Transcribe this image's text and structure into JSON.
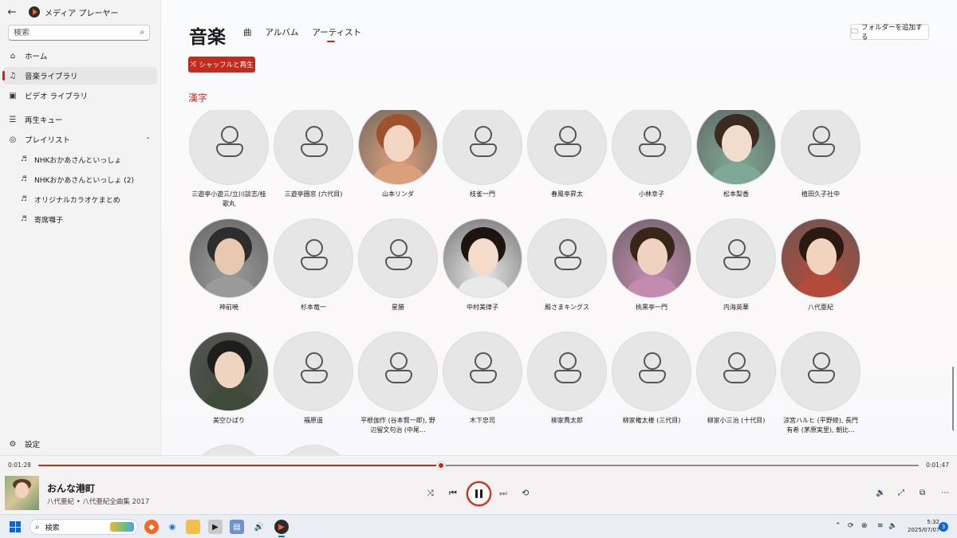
{
  "window": {
    "title": "メディア プレーヤー",
    "back_icon": "back-arrow-icon",
    "minimize": "—",
    "maximize": "❐",
    "close": "✕"
  },
  "sidebar": {
    "search_placeholder": "検索",
    "nav": [
      {
        "label": "ホーム",
        "icon": "home-icon"
      },
      {
        "label": "音楽ライブラリ",
        "icon": "music-note-icon",
        "active": true
      },
      {
        "label": "ビデオ ライブラリ",
        "icon": "video-icon"
      },
      {
        "label": "再生キュー",
        "icon": "queue-icon"
      },
      {
        "label": "プレイリスト",
        "icon": "playlist-icon",
        "expanded": true
      }
    ],
    "playlists": [
      "NHKおかあさんといっしょ",
      "NHKおかあさんといっしょ (2)",
      "オリジナルカラオケまとめ",
      "寄席囃子"
    ],
    "settings_label": "設定"
  },
  "main": {
    "heading": "音楽",
    "tabs": [
      "曲",
      "アルバム",
      "アーティスト"
    ],
    "selected_tab": "アーティスト",
    "add_folder_label": "フォルダーを追加する",
    "shuffle_label": "シャッフルと再生",
    "section_label": "漢字",
    "artists": [
      {
        "name": "三遊亭小遊三/立川談志/桂歌丸",
        "photo": false
      },
      {
        "name": "三遊亭圓窓 (六代目)",
        "photo": false
      },
      {
        "name": "山本リンダ",
        "photo": true
      },
      {
        "name": "枝雀一門",
        "photo": false
      },
      {
        "name": "春風亭昇太",
        "photo": false
      },
      {
        "name": "小林幸子",
        "photo": false
      },
      {
        "name": "松本梨香",
        "photo": true
      },
      {
        "name": "植田久子社中",
        "photo": false
      },
      {
        "name": "神前暁",
        "photo": true
      },
      {
        "name": "杉本竜一",
        "photo": false
      },
      {
        "name": "星勝",
        "photo": false
      },
      {
        "name": "中村美律子",
        "photo": true
      },
      {
        "name": "殿さまキングス",
        "photo": false
      },
      {
        "name": "桃黒亭一門",
        "photo": true
      },
      {
        "name": "内海英華",
        "photo": false
      },
      {
        "name": "八代亜紀",
        "photo": true
      },
      {
        "name": "美空ひばり",
        "photo": true
      },
      {
        "name": "福原遥",
        "photo": false
      },
      {
        "name": "平根伽作 (谷本賢一郎), 野辺留文句治 (中尾...",
        "photo": false
      },
      {
        "name": "木下忠司",
        "photo": false
      },
      {
        "name": "柳家喬太郎",
        "photo": false
      },
      {
        "name": "柳家権太楼 (三代目)",
        "photo": false
      },
      {
        "name": "柳家小三治 (十代目)",
        "photo": false
      },
      {
        "name": "涼宮ハルヒ (平野綾), 長門有希 (茅原実里), 朝比...",
        "photo": false
      },
      {
        "name": "",
        "photo": false
      },
      {
        "name": "",
        "photo": false
      }
    ]
  },
  "player": {
    "elapsed": "0:01:28",
    "total": "0:01:47",
    "progress": 0.4575,
    "title": "おんな港町",
    "subtitle": "八代亜紀 • 八代亜紀全曲集 2017",
    "accent": "#c42b1c"
  },
  "taskbar": {
    "search_placeholder": "検索",
    "time": "5:32",
    "date": "2025/07/07",
    "notifications": "3"
  }
}
